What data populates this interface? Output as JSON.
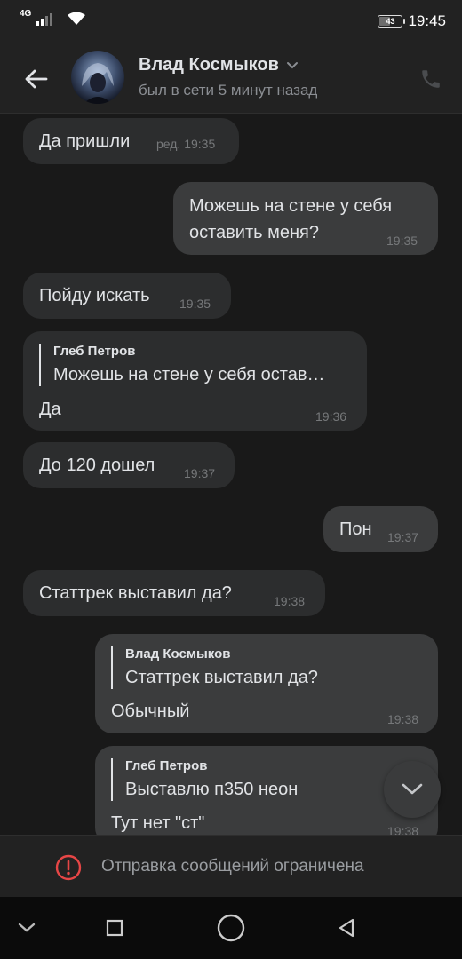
{
  "status_bar": {
    "network": "4G",
    "battery": "43",
    "battery_level": 0.43,
    "time": "19:45"
  },
  "header": {
    "contact_name": "Влад Космыков",
    "status": "был в сети 5 минут назад"
  },
  "messages": [
    {
      "direction": "in",
      "text": "Да пришли",
      "meta": "ред. 19:35"
    },
    {
      "direction": "out",
      "text_lines": [
        "Можешь на стене у себя",
        "оставить меня?"
      ],
      "time": "19:35"
    },
    {
      "direction": "in",
      "text": "Пойду искать",
      "time": "19:35"
    },
    {
      "direction": "in",
      "reply_author": "Глеб Петров",
      "reply_text": "Можешь на стене у себя остав…",
      "text": "Да",
      "time": "19:36"
    },
    {
      "direction": "in",
      "text": "До 120 дошел",
      "time": "19:37"
    },
    {
      "direction": "out",
      "text": "Пон",
      "time": "19:37"
    },
    {
      "direction": "in",
      "text": "Статтрек выставил да?",
      "time": "19:38"
    },
    {
      "direction": "out",
      "reply_author": "Влад Космыков",
      "reply_text": "Статтрек выставил да?",
      "text": "Обычный",
      "time": "19:38"
    },
    {
      "direction": "out",
      "reply_author": "Глеб Петров",
      "reply_text": "Выставлю п350 неон",
      "text": "Тут нет \"ст\"",
      "time": "19:38"
    }
  ],
  "footer": {
    "restricted_text": "Отправка сообщений ограничена"
  },
  "icons": {
    "back": "arrow-left-icon",
    "dropdown": "chevron-down-icon",
    "call": "phone-icon",
    "warning": "exclamation-circle-icon",
    "scroll": "chevron-down-icon"
  },
  "colors": {
    "background": "#191919",
    "bar": "#222222",
    "bubble_in": "#2c2d2e",
    "bubble_out": "#3b3c3d",
    "warning": "#e64646"
  }
}
